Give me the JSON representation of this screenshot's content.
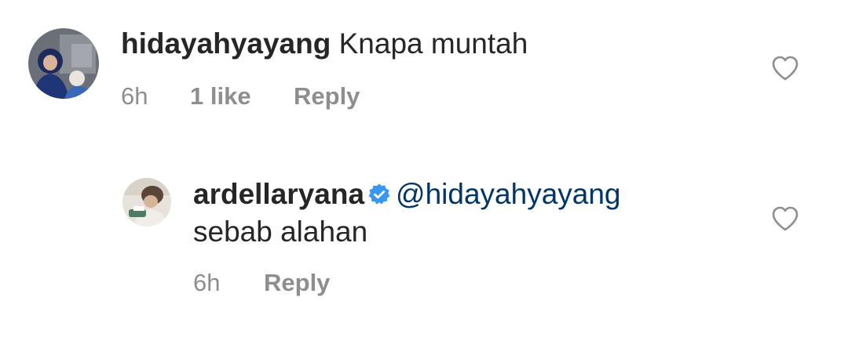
{
  "comments": [
    {
      "username": "hidayahyayang",
      "text": "Knapa muntah",
      "time": "6h",
      "likes": "1 like",
      "reply_label": "Reply",
      "avatar_icon": "user-avatar-photo",
      "like_icon": "heart-outline-icon"
    },
    {
      "username": "ardellaryana",
      "verified": true,
      "mention": "@hidayahyayang",
      "text": "sebab alahan",
      "time": "6h",
      "reply_label": "Reply",
      "avatar_icon": "user-avatar-photo",
      "like_icon": "heart-outline-icon"
    }
  ],
  "colors": {
    "text": "#262626",
    "secondary": "#8e8e8e",
    "mention": "#003569",
    "verified_badge": "#3897f0"
  }
}
